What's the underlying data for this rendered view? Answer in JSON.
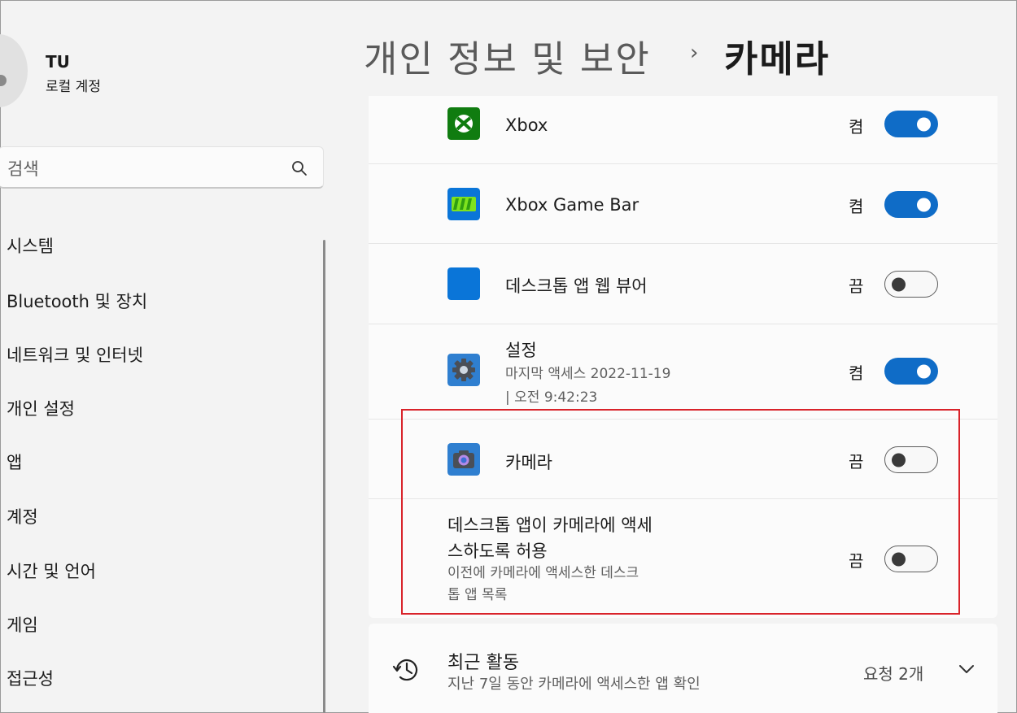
{
  "account": {
    "name": "TU",
    "type": "로컬 계정"
  },
  "search": {
    "placeholder": "검색"
  },
  "nav": {
    "items": [
      {
        "label": "시스템"
      },
      {
        "label": "Bluetooth 및 장치"
      },
      {
        "label": "네트워크 및 인터넷"
      },
      {
        "label": "개인 설정"
      },
      {
        "label": "앱"
      },
      {
        "label": "계정"
      },
      {
        "label": "시간 및 언어"
      },
      {
        "label": "게임"
      },
      {
        "label": "접근성"
      }
    ]
  },
  "breadcrumb": {
    "parent": "개인 정보 및 보안",
    "separator": "›",
    "current": "카메라"
  },
  "apps": [
    {
      "name": "Xbox",
      "state": "켬",
      "on": true,
      "icon": "xbox-icon"
    },
    {
      "name": "Xbox Game Bar",
      "state": "켬",
      "on": true,
      "icon": "xbox-game-bar-icon"
    },
    {
      "name": "데스크톱 앱 웹 뷰어",
      "state": "끔",
      "on": false,
      "icon": "desktop-web-viewer-icon"
    },
    {
      "name": "설정",
      "last_access_line1": "마지막 액세스 2022-11-19",
      "last_access_line2": "|  오전 9:42:23",
      "state": "켬",
      "on": true,
      "icon": "settings-gear-icon"
    },
    {
      "name": "카메라",
      "state": "끔",
      "on": false,
      "icon": "camera-app-icon"
    }
  ],
  "desktop_apps": {
    "title_line1": "데스크톱 앱이 카메라에 액세",
    "title_line2": "스하도록 허용",
    "desc_line1": "이전에 카메라에 액세스한 데스크",
    "desc_line2": "톱 앱 목록",
    "state": "끔",
    "on": false
  },
  "recent_activity": {
    "title": "최근 활동",
    "subtitle": "지난 7일 동안 카메라에 액세스한 앱 확인",
    "count": "요청 2개"
  },
  "colors": {
    "accent": "#0f6cc7",
    "highlight_border": "#d9232a",
    "xbox_green": "#107c10"
  }
}
